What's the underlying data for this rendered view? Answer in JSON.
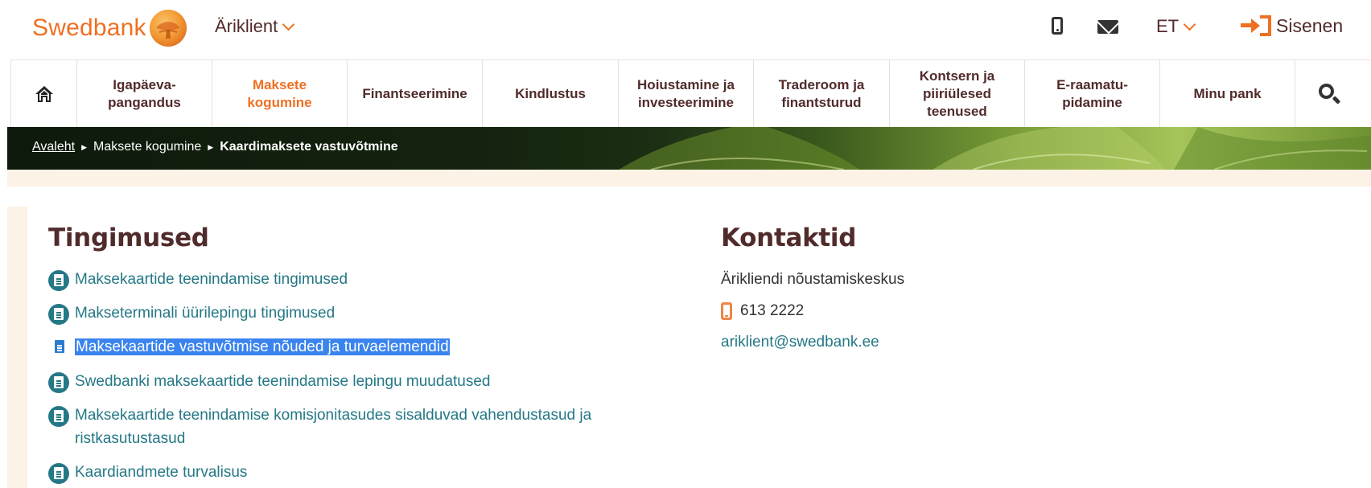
{
  "header": {
    "logo_text": "Swedbank",
    "client_selector": "Äriklient",
    "language": "ET",
    "login_label": "Sisenen"
  },
  "nav": {
    "items": [
      {
        "label": "Igapäeva-\npangandus"
      },
      {
        "label": "Maksete\nkogumine",
        "active": true
      },
      {
        "label": "Finantseerimine"
      },
      {
        "label": "Kindlustus"
      },
      {
        "label": "Hoiustamine ja\ninvesteerimine"
      },
      {
        "label": "Traderoom ja\nfinantsturud"
      },
      {
        "label": "Kontsern ja\npiiriülesed\nteenused"
      },
      {
        "label": "E-raamatu-\npidamine"
      },
      {
        "label": "Minu pank"
      }
    ]
  },
  "breadcrumb": {
    "home": "Avaleht",
    "parent": "Maksete kogumine",
    "current": "Kaardimaksete vastuvõtmine"
  },
  "conditions": {
    "title": "Tingimused",
    "items": [
      {
        "label": "Maksekaartide teenindamise tingimused"
      },
      {
        "label": "Makseterminali üürilepingu tingimused"
      },
      {
        "label": "Maksekaartide vastuvõtmise nõuded ja turvaelemendid",
        "selected": true
      },
      {
        "label": "Swedbanki maksekaartide teenindamise lepingu muudatused"
      },
      {
        "label": "Maksekaartide teenindamise komisjonitasudes sisalduvad vahendustasud ja ristkasutustasud"
      },
      {
        "label": "Kaardiandmete turvalisus"
      }
    ]
  },
  "contacts": {
    "title": "Kontaktid",
    "center_name": "Ärikliendi nõustamiskeskus",
    "phone": "613 2222",
    "email": "ariklient@swedbank.ee"
  },
  "colors": {
    "brand_orange": "#ee7023",
    "heading_brown": "#512b2b",
    "link_teal": "#257886",
    "selection_blue": "#3a84ee",
    "cream": "#fdf2e6"
  }
}
